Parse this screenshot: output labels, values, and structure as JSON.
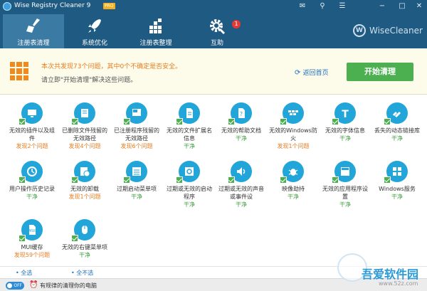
{
  "app": {
    "title": "Wise Registry Cleaner 9",
    "badge": "PRO"
  },
  "nav": {
    "tabs": [
      {
        "label": "注册表清理",
        "icon": "broom-icon"
      },
      {
        "label": "系统优化",
        "icon": "rocket-icon"
      },
      {
        "label": "注册表整理",
        "icon": "blocks-icon"
      },
      {
        "label": "互助",
        "icon": "gear-icon"
      }
    ],
    "notify_count": "1"
  },
  "brand": {
    "name": "WiseCleaner",
    "mark": "W"
  },
  "summary": {
    "main": "本次共发现73个问题，其中0个不确定是否安全。",
    "hint": "请立即\"开始清理\"解决这些问题。",
    "back": "返回首页",
    "start": "开始清理"
  },
  "items": [
    {
      "label": "无效的插件以及组件",
      "status": "发现2个问题",
      "type": "found"
    },
    {
      "label": "已删除文件残留的无效路径",
      "status": "发现4个问题",
      "type": "found"
    },
    {
      "label": "已注册程序残留的无效路径",
      "status": "发现6个问题",
      "type": "found"
    },
    {
      "label": "无效的文件扩展名信息",
      "status": "干净",
      "type": "clean"
    },
    {
      "label": "无效的帮助文档",
      "status": "干净",
      "type": "clean"
    },
    {
      "label": "无效的Windows防火",
      "status": "发现1个问题",
      "type": "found"
    },
    {
      "label": "无效的字体信息",
      "status": "干净",
      "type": "clean"
    },
    {
      "label": "丢失的动态链接库",
      "status": "干净",
      "type": "clean"
    },
    {
      "label": "用户操作历史记录",
      "status": "干净",
      "type": "clean"
    },
    {
      "label": "无效的卸载",
      "status": "发现1个问题",
      "type": "found"
    },
    {
      "label": "过期启动菜单项",
      "status": "干净",
      "type": "clean"
    },
    {
      "label": "过期或无效的启动程序",
      "status": "干净",
      "type": "clean"
    },
    {
      "label": "过期或无效的声音或事件设",
      "status": "干净",
      "type": "clean"
    },
    {
      "label": "映像劫持",
      "status": "干净",
      "type": "clean"
    },
    {
      "label": "无效的应用程序设置",
      "status": "干净",
      "type": "clean"
    },
    {
      "label": "Windows服务",
      "status": "干净",
      "type": "clean"
    },
    {
      "label": "MUI缓存",
      "status": "发现59个问题",
      "type": "found"
    },
    {
      "label": "无效的右键菜单项",
      "status": "干净",
      "type": "clean"
    }
  ],
  "selection": {
    "all": "全选",
    "none": "全不选"
  },
  "statusbar": {
    "toggle": "OFF",
    "text": "有规律的清理你的电脑"
  },
  "watermark": {
    "text": "吾爱软件园",
    "url": "www.52z.com"
  },
  "colors": {
    "header": "#1e5a82",
    "accent": "#22a5d8",
    "start": "#4caf50",
    "warn": "#e67e22"
  }
}
